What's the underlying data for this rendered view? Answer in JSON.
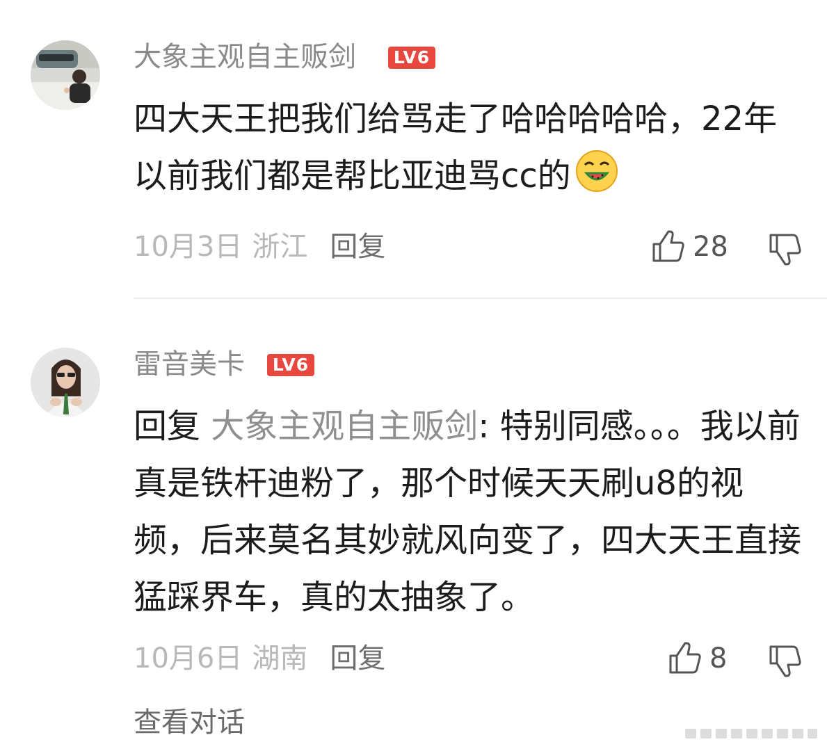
{
  "comments": [
    {
      "username": "大象主观自主贩剑",
      "level": "LV6",
      "text": "四大天王把我们给骂走了哈哈哈哈哈，22年以前我们都是帮比亚迪骂cc的",
      "emoji": "laughing-eating-watermelon-emoji",
      "date": "10月3日",
      "location": "浙江",
      "reply_label": "回复",
      "likes": "28"
    },
    {
      "username": "雷音美卡",
      "level": "LV6",
      "reply_prefix": "回复",
      "reply_to": "大象主观自主贩剑",
      "text": ": 特别同感。。。我以前真是铁杆迪粉了，那个时候天天刷u8的视频，后来莫名其妙就风向变了，四大天王直接猛踩界车，真的太抽象了。",
      "date": "10月6日",
      "location": "湖南",
      "reply_label": "回复",
      "likes": "8"
    }
  ],
  "view_conversation_label": "查看对话",
  "colors": {
    "level_badge": "#e8473f",
    "username": "#8a8a8a",
    "text": "#1c1c1c",
    "meta": "#b8b8b8"
  }
}
